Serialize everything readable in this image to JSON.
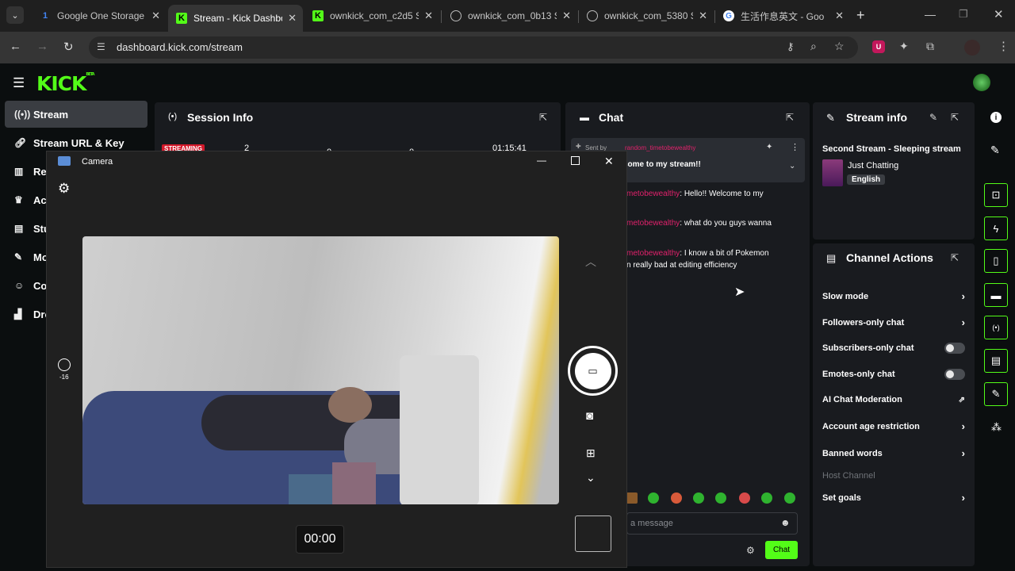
{
  "browser": {
    "tabs": [
      {
        "title": "Google One Storage",
        "icon": "google-one-icon",
        "active": false
      },
      {
        "title": "Stream - Kick Dashbo",
        "icon": "kick-icon",
        "active": true
      },
      {
        "title": "ownkick_com_c2d5 S",
        "icon": "kick-icon",
        "active": false
      },
      {
        "title": "ownkick_com_0b13 S",
        "icon": "globe-icon",
        "active": false
      },
      {
        "title": "ownkick_com_5380 S",
        "icon": "globe-icon",
        "active": false
      },
      {
        "title": "生活作息英文 - Goo",
        "icon": "google-icon",
        "active": false
      }
    ],
    "url": "dashboard.kick.com/stream"
  },
  "kick": {
    "logo": "KICK",
    "logo_tag": "BETA",
    "sidebar": [
      {
        "label": "Stream",
        "icon": "broadcast-icon"
      },
      {
        "label": "Stream URL & Key",
        "icon": "link-icon"
      },
      {
        "label": "Rev",
        "icon": "chart-icon"
      },
      {
        "label": "Ach",
        "icon": "trophy-icon"
      },
      {
        "label": "Stu",
        "icon": "layers-icon"
      },
      {
        "label": "Mo",
        "icon": "wrench-icon"
      },
      {
        "label": "Co",
        "icon": "users-icon"
      },
      {
        "label": "Dro",
        "icon": "gift-icon"
      }
    ],
    "session": {
      "title": "Session Info",
      "badge": "STREAMING",
      "stat1": "2",
      "stat2": "0",
      "stat3": "0",
      "time": "01:15:41"
    },
    "chat": {
      "title": "Chat",
      "pinned_by": "Sent by",
      "pinned_user": "random_timetobewealthy",
      "pinned_text": "come to my stream!!",
      "messages": [
        {
          "user": "metobewealthy",
          "text": ": Hello!! Welcome to my"
        },
        {
          "user": "metobewealthy",
          "text": ": what do you guys wanna"
        },
        {
          "user": "metobewealthy",
          "text": ": I know a bit of Pokemon",
          "text2": "n really bad at editing efficiency"
        }
      ],
      "placeholder": "a message",
      "send_label": "Chat"
    },
    "stream_info": {
      "title": "Stream info",
      "stream_title": "Second Stream - Sleeping stream",
      "category": "Just Chatting",
      "language": "English"
    },
    "channel_actions": {
      "title": "Channel Actions",
      "items": [
        {
          "label": "Slow mode",
          "control": "chevron"
        },
        {
          "label": "Followers-only chat",
          "control": "chevron"
        },
        {
          "label": "Subscribers-only chat",
          "control": "toggle"
        },
        {
          "label": "Emotes-only chat",
          "control": "toggle"
        },
        {
          "label": "AI Chat Moderation",
          "control": "external"
        },
        {
          "label": "Account age restriction",
          "control": "chevron"
        },
        {
          "label": "Banned words",
          "control": "chevron"
        }
      ],
      "host_channel": "Host Channel",
      "set_goals": "Set goals"
    }
  },
  "camera": {
    "title": "Camera",
    "exposure": "-16",
    "timer": "00:00"
  },
  "colors": {
    "kick_green": "#53fc18",
    "chat_user": "#e0216b",
    "streaming_red": "#d3182a"
  }
}
